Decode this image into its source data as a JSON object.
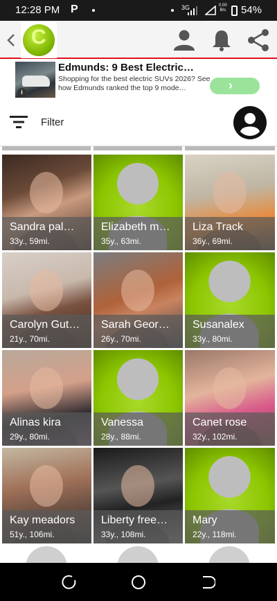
{
  "status_bar": {
    "time": "12:28 PM",
    "app_letter": "P",
    "network_type": "3G",
    "data_rate_value": "0.00",
    "data_rate_unit": "B/s",
    "battery": "54%"
  },
  "app_bar": {
    "logo_letter": "C",
    "icons": [
      "back-arrow-icon",
      "profile-icon",
      "notification-bell-icon",
      "share-icon"
    ]
  },
  "ad": {
    "title": "Edmunds: 9 Best Electric…",
    "description": "Shopping for the best electric SUVs 2026? See how Edmunds ranked the top 9 mode…",
    "info_label": "i",
    "cta_icon": "chevron-right-icon"
  },
  "filter": {
    "label": "Filter",
    "icons": [
      "filter-lines-icon",
      "account-avatar-icon"
    ]
  },
  "profiles": [
    {
      "name": "Sandra pal…",
      "meta": "33y., 59mi.",
      "photo": "photo"
    },
    {
      "name": "Elizabeth m…",
      "meta": "35y., 63mi.",
      "photo": "placeholder"
    },
    {
      "name": "Liza Track",
      "meta": "36y., 69mi.",
      "photo": "photo"
    },
    {
      "name": "Carolyn Gut…",
      "meta": "21y., 70mi.",
      "photo": "photo"
    },
    {
      "name": "Sarah Geor…",
      "meta": "26y., 70mi.",
      "photo": "photo"
    },
    {
      "name": "Susanalex",
      "meta": "33y., 80mi.",
      "photo": "placeholder"
    },
    {
      "name": "Alinas kira",
      "meta": "29y., 80mi.",
      "photo": "photo"
    },
    {
      "name": "Vanessa",
      "meta": "28y., 88mi.",
      "photo": "placeholder"
    },
    {
      "name": "Canet rose",
      "meta": "32y., 102mi.",
      "photo": "photo"
    },
    {
      "name": "Kay meadors",
      "meta": "51y., 106mi.",
      "photo": "photo"
    },
    {
      "name": "Liberty free…",
      "meta": "33y., 108mi.",
      "photo": "photo"
    },
    {
      "name": "Mary",
      "meta": "22y., 118mi.",
      "photo": "placeholder"
    }
  ],
  "colors": {
    "accent_green": "#8cc600",
    "header_red_line": "#e0101e",
    "caption_overlay": "#5a5a5a"
  },
  "nav_bar": {
    "icons": [
      "recent-apps-icon",
      "home-icon",
      "back-icon"
    ]
  }
}
